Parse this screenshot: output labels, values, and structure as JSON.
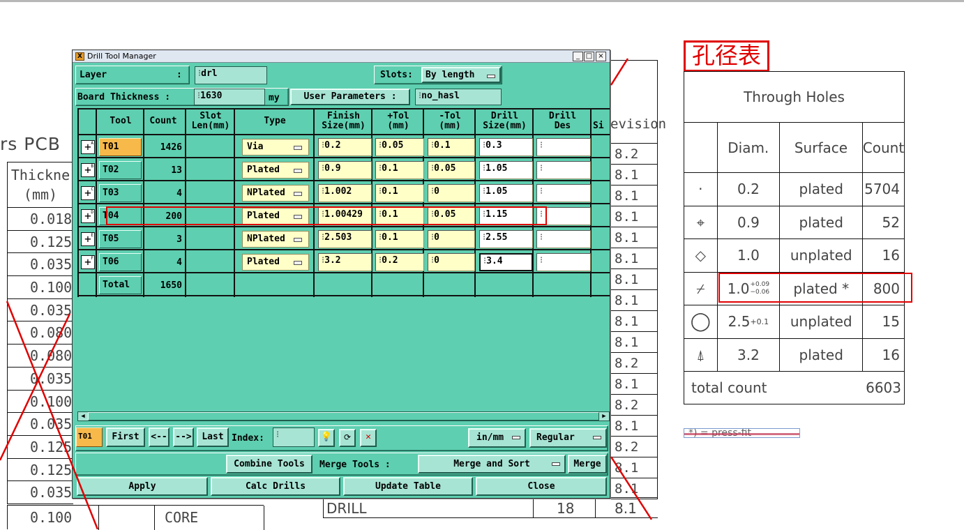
{
  "window": {
    "title": "Drill Tool Manager",
    "minimize_label": "_",
    "maximize_label": "□",
    "close_label": "×"
  },
  "top": {
    "layer_label": "Layer",
    "layer_colon": ":",
    "layer_value": "drl",
    "slots_label": "Slots:",
    "slots_value": "By length",
    "board_thickness_label": "Board Thickness :",
    "board_thickness_value": "1630",
    "board_thickness_unit": "my",
    "user_params_label": "User Parameters :",
    "user_params_value": "no_hasl"
  },
  "table": {
    "headers": {
      "tool": "Tool",
      "count": "Count",
      "slot_len": [
        "Slot",
        "Len(mm)"
      ],
      "type": "Type",
      "finish": [
        "Finish",
        "Size(mm)"
      ],
      "ptol": [
        "+Tol",
        "(mm)"
      ],
      "mtol": [
        "-Tol",
        "(mm)"
      ],
      "drill_size": [
        "Drill",
        "Size(mm)"
      ],
      "drill_des": [
        "Drill",
        "Des"
      ],
      "si": "Si"
    },
    "rows": [
      {
        "tool": "T01",
        "count": "1426",
        "type": "Via",
        "finish": "0.2",
        "ptol": "0.05",
        "mtol": "0.1",
        "drill": "0.3",
        "des": ""
      },
      {
        "tool": "T02",
        "count": "13",
        "type": "Plated",
        "finish": "0.9",
        "ptol": "0.1",
        "mtol": "0.05",
        "drill": "1.05",
        "des": ""
      },
      {
        "tool": "T03",
        "count": "4",
        "type": "NPlated",
        "finish": "1.002",
        "ptol": "0.1",
        "mtol": "0",
        "drill": "1.05",
        "des": ""
      },
      {
        "tool": "T04",
        "count": "200",
        "type": "Plated",
        "finish": "1.00429",
        "ptol": "0.1",
        "mtol": "0.05",
        "drill": "1.15",
        "des": ""
      },
      {
        "tool": "T05",
        "count": "3",
        "type": "NPlated",
        "finish": "2.503",
        "ptol": "0.1",
        "mtol": "0",
        "drill": "2.55",
        "des": ""
      },
      {
        "tool": "T06",
        "count": "4",
        "type": "Plated",
        "finish": "3.2",
        "ptol": "0.2",
        "mtol": "0",
        "drill": "3.4",
        "des": ""
      }
    ],
    "total_label": "Total",
    "total_count": "1650"
  },
  "nav": {
    "current_tool": "T01",
    "first": "First",
    "prev": "<--",
    "next": "-->",
    "last": "Last",
    "index_label": "Index:",
    "index_value": "",
    "units": "in/mm",
    "mode": "Regular"
  },
  "actions": {
    "combine_tools": "Combine Tools",
    "merge_tools_label": "Merge Tools :",
    "merge_mode": "Merge and Sort",
    "merge": "Merge",
    "apply": "Apply",
    "calc_drills": "Calc Drills",
    "update_table": "Update Table",
    "close": "Close"
  },
  "background": {
    "pcb_title": "rs PCB",
    "thickness_header": [
      "Thickne",
      "(mm)"
    ],
    "thickness_values": [
      "0.018",
      "0.125",
      "0.035",
      "0.100",
      "0.035",
      "0.080",
      "0.080",
      "0.035",
      "0.100",
      "0.035",
      "0.125",
      "0.125",
      "0.035"
    ],
    "bottom_value": "0.100",
    "bottom_core": "CORE",
    "drill_label": "DRILL",
    "drill_count": "18",
    "revision_header": "evision",
    "revision_values": [
      "8.2",
      "8.1",
      "8.1",
      "8.1",
      "8.1",
      "8.1",
      "8.1",
      "8.1",
      "8.1",
      "8.1",
      "8.2",
      "8.1",
      "8.2",
      "8.1",
      "8.2",
      "8.1",
      "8.1",
      "8.1"
    ]
  },
  "hole_table": {
    "title": "孔径表",
    "caption": "Through Holes",
    "headers": [
      "Diam.",
      "Surface",
      "Count"
    ],
    "rows": [
      {
        "symbol": "·",
        "diam": "0.2",
        "surface": "plated",
        "count": "5704"
      },
      {
        "symbol": "⌖",
        "diam": "0.9",
        "surface": "plated",
        "count": "52"
      },
      {
        "symbol": "◇",
        "diam": "1.0",
        "surface": "unplated",
        "count": "16"
      },
      {
        "symbol": "⌿",
        "diam": "1.0",
        "surface": "plated *",
        "count": "800",
        "tol_plus": "+0.09",
        "tol_minus": "−0.06"
      },
      {
        "symbol": "◯",
        "diam": "2.5",
        "surface": "unplated",
        "count": "15",
        "sup": "+0.1"
      },
      {
        "symbol": "⍋",
        "diam": "3.2",
        "surface": "plated",
        "count": "16"
      }
    ],
    "total_label": "total count",
    "total_value": "6603",
    "note": "*) = press-fit"
  },
  "colors": {
    "window_bg": "#5ecfb0",
    "button_bg": "#a7e4d4",
    "input_bg": "#ffffc8",
    "selected_tool": "#f6b94a",
    "highlight": "#e00000"
  }
}
